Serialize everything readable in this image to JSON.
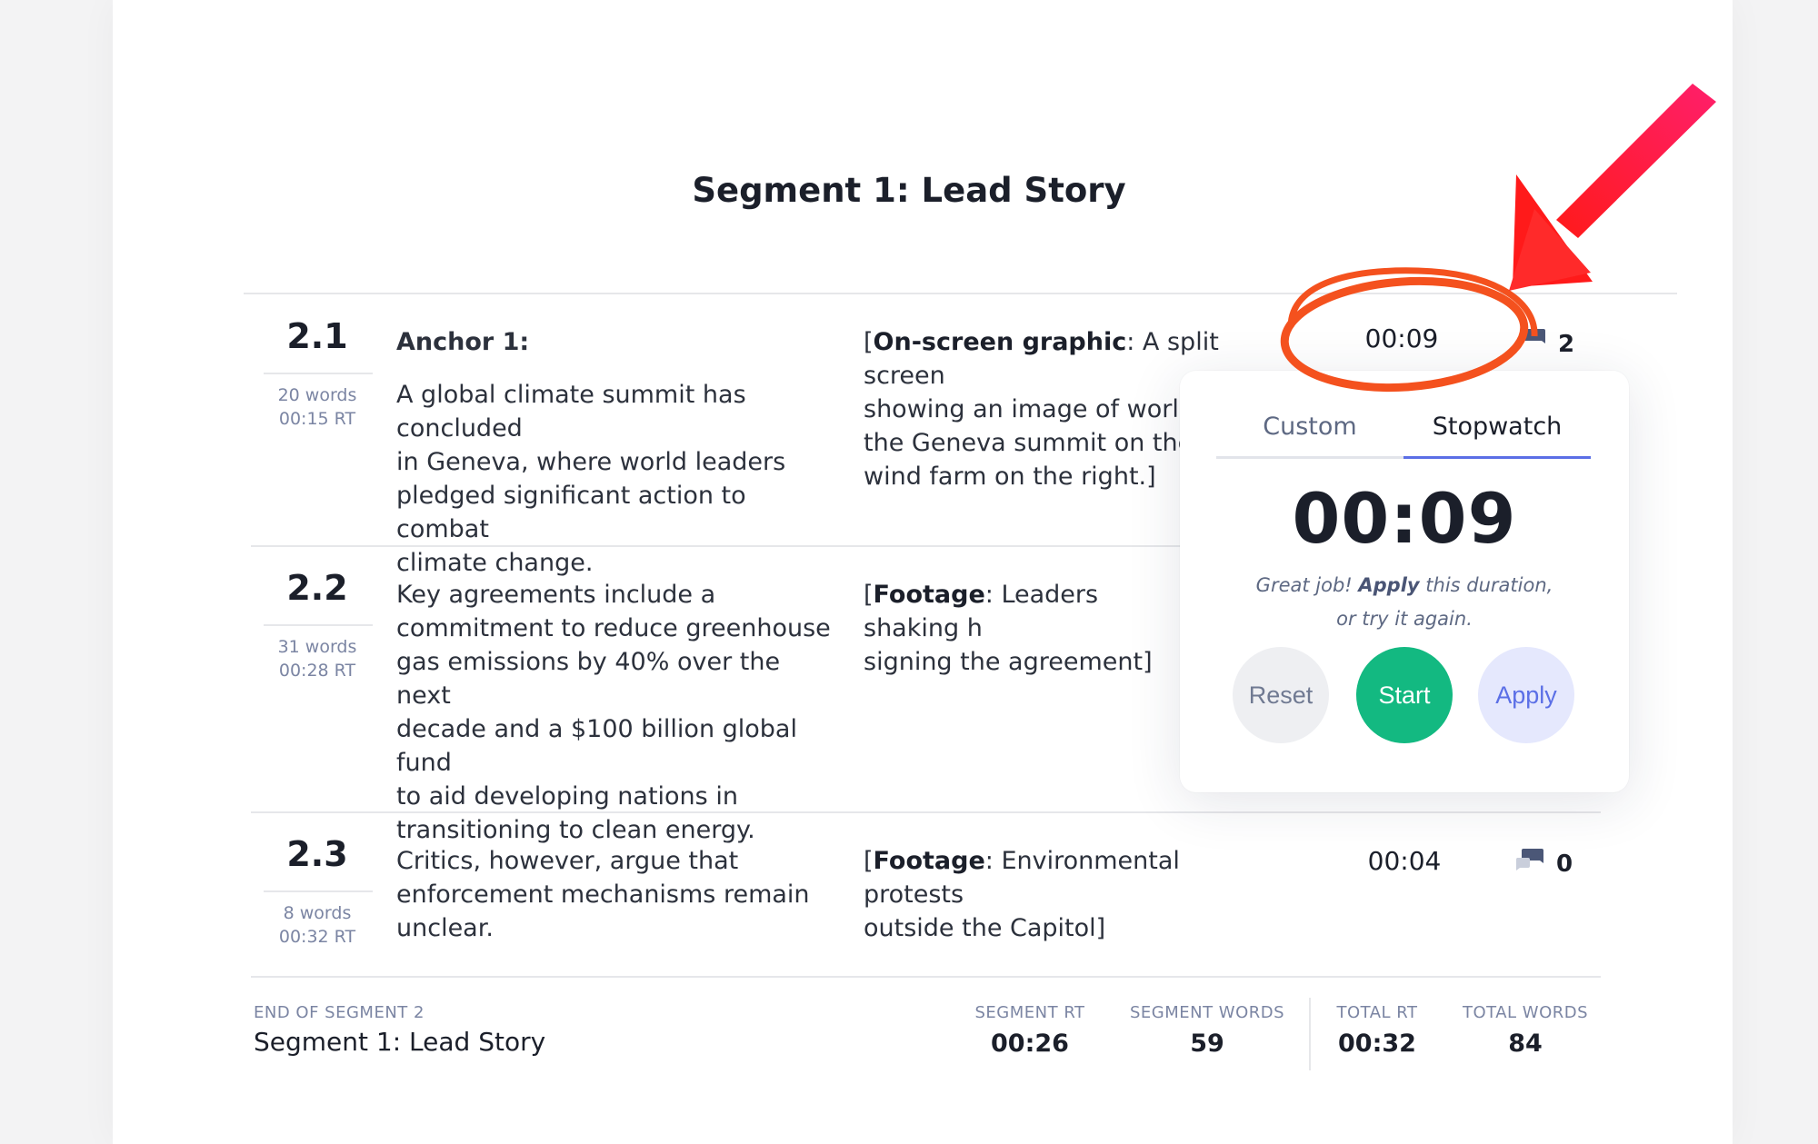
{
  "title": "Segment 1: Lead Story",
  "rows": [
    {
      "num": "2.1",
      "words": "20 words",
      "rt": "00:15 RT",
      "speaker": "Anchor 1:",
      "script_lines": [
        "A global climate summit has concluded",
        "in Geneva, where world leaders",
        "pledged significant action to combat",
        "climate change."
      ],
      "visual_label": "On-screen graphic",
      "visual_lines": [
        ": A split screen",
        "showing an image of world l",
        "the Geneva summit on the l",
        "wind farm on the right.]"
      ],
      "duration": "00:09",
      "comments": "2"
    },
    {
      "num": "2.2",
      "words": "31 words",
      "rt": "00:28 RT",
      "script_lines": [
        "Key agreements include a",
        "commitment to reduce greenhouse",
        "gas emissions by 40% over the next",
        "decade and a $100 billion global fund",
        "to aid developing nations in",
        "transitioning to clean energy."
      ],
      "visual_label": "Footage",
      "visual_lines": [
        ": Leaders shaking h",
        "signing the agreement]"
      ]
    },
    {
      "num": "2.3",
      "words": "8 words",
      "rt": "00:32 RT",
      "script_lines": [
        "Critics, however, argue that",
        "enforcement mechanisms remain",
        "unclear."
      ],
      "visual_label": "Footage",
      "visual_lines": [
        ": Environmental protests",
        "outside the Capitol]"
      ],
      "duration": "00:04",
      "comments": "0"
    }
  ],
  "footer": {
    "end_label": "END OF SEGMENT 2",
    "segment_name": "Segment 1: Lead Story",
    "segment_rt_label": "SEGMENT RT",
    "segment_rt": "00:26",
    "segment_words_label": "SEGMENT WORDS",
    "segment_words": "59",
    "total_rt_label": "TOTAL RT",
    "total_rt": "00:32",
    "total_words_label": "TOTAL WORDS",
    "total_words": "84"
  },
  "popup": {
    "tab_custom": "Custom",
    "tab_stopwatch": "Stopwatch",
    "time": "00:09",
    "hint_pre": "Great job! ",
    "hint_bold": "Apply",
    "hint_post": " this duration,",
    "hint_line2": "or try it again.",
    "reset_label": "Reset",
    "start_label": "Start",
    "apply_label": "Apply"
  },
  "colors": {
    "accent": "#5b6fe6",
    "start_green": "#13b981",
    "annotation_orange": "#f4511e",
    "annotation_red": "#ff1744"
  },
  "icons": {
    "comment": "comment-bubble-icon"
  }
}
